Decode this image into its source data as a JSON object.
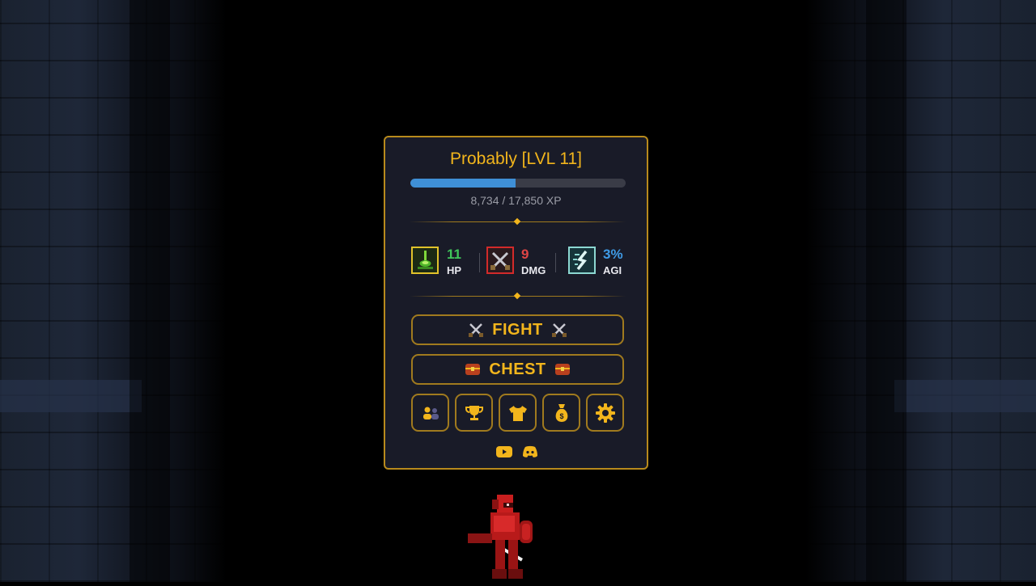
{
  "player": {
    "name_level": "Probably [LVL 11]",
    "xp_text": "8,734 / 17,850 XP",
    "xp_current": 8734,
    "xp_max": 17850
  },
  "stats": {
    "hp": {
      "value": "11",
      "label": "HP",
      "icon": "hp-potion-icon",
      "color": "#3fc65a"
    },
    "dmg": {
      "value": "9",
      "label": "DMG",
      "icon": "crossed-swords-icon",
      "color": "#e04545"
    },
    "agi": {
      "value": "3%",
      "label": "AGI",
      "icon": "dash-icon",
      "color": "#3f9be6"
    }
  },
  "actions": {
    "fight_label": "FIGHT",
    "chest_label": "CHEST"
  },
  "menu_icons": [
    "friends-icon",
    "trophy-icon",
    "shirt-icon",
    "money-bag-icon",
    "gear-icon"
  ],
  "social_icons": [
    "youtube-icon",
    "discord-icon"
  ],
  "colors": {
    "accent": "#f2b51c",
    "border": "#a07a1e",
    "panel": "#191b28",
    "xp_bar": "#3f8fd6"
  }
}
